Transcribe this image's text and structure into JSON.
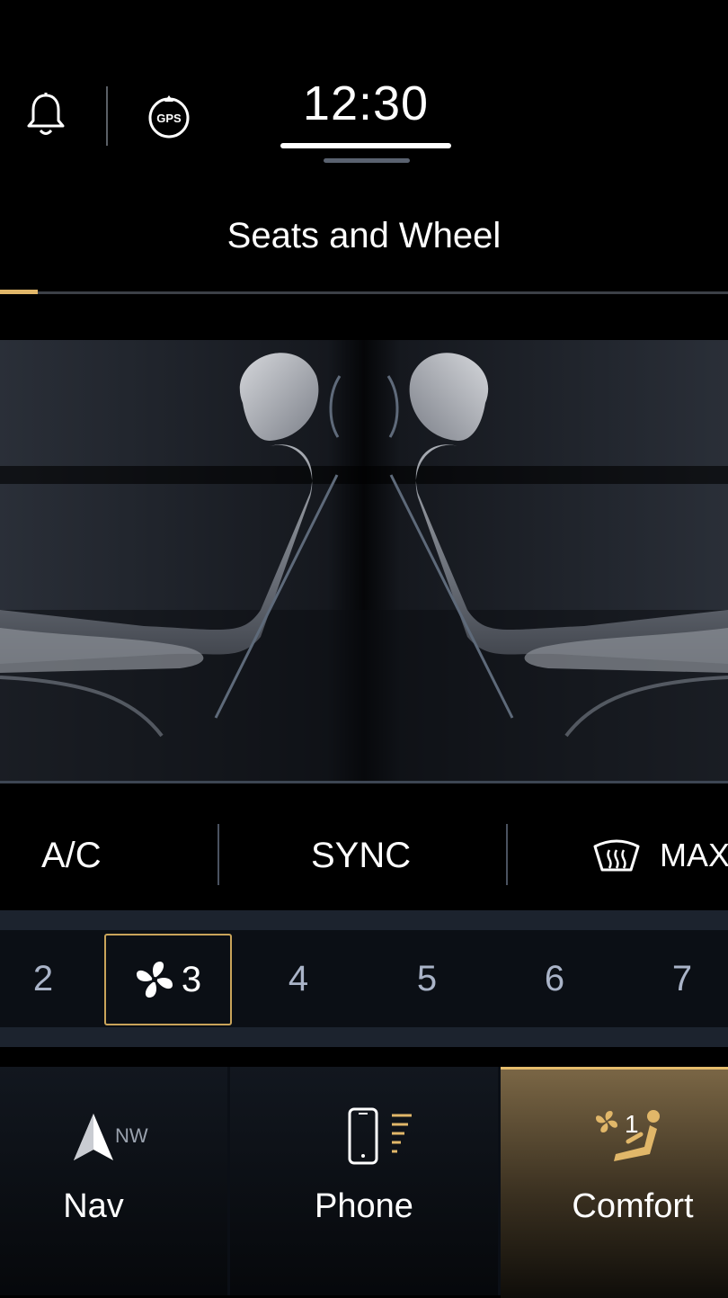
{
  "status": {
    "time": "12:30",
    "gps_label": "GPS"
  },
  "page_title": "Seats and Wheel",
  "climate": {
    "ac_label": "A/C",
    "sync_label": "SYNC",
    "max_label": "MAX"
  },
  "fan": {
    "levels": [
      "2",
      "3",
      "4",
      "5",
      "6",
      "7"
    ],
    "selected": "3"
  },
  "nav": {
    "nav_label": "Nav",
    "nav_heading": "NW",
    "phone_label": "Phone",
    "comfort_label": "Comfort",
    "comfort_fan_level": "1"
  },
  "colors": {
    "accent": "#e1b769",
    "background": "#000000"
  }
}
